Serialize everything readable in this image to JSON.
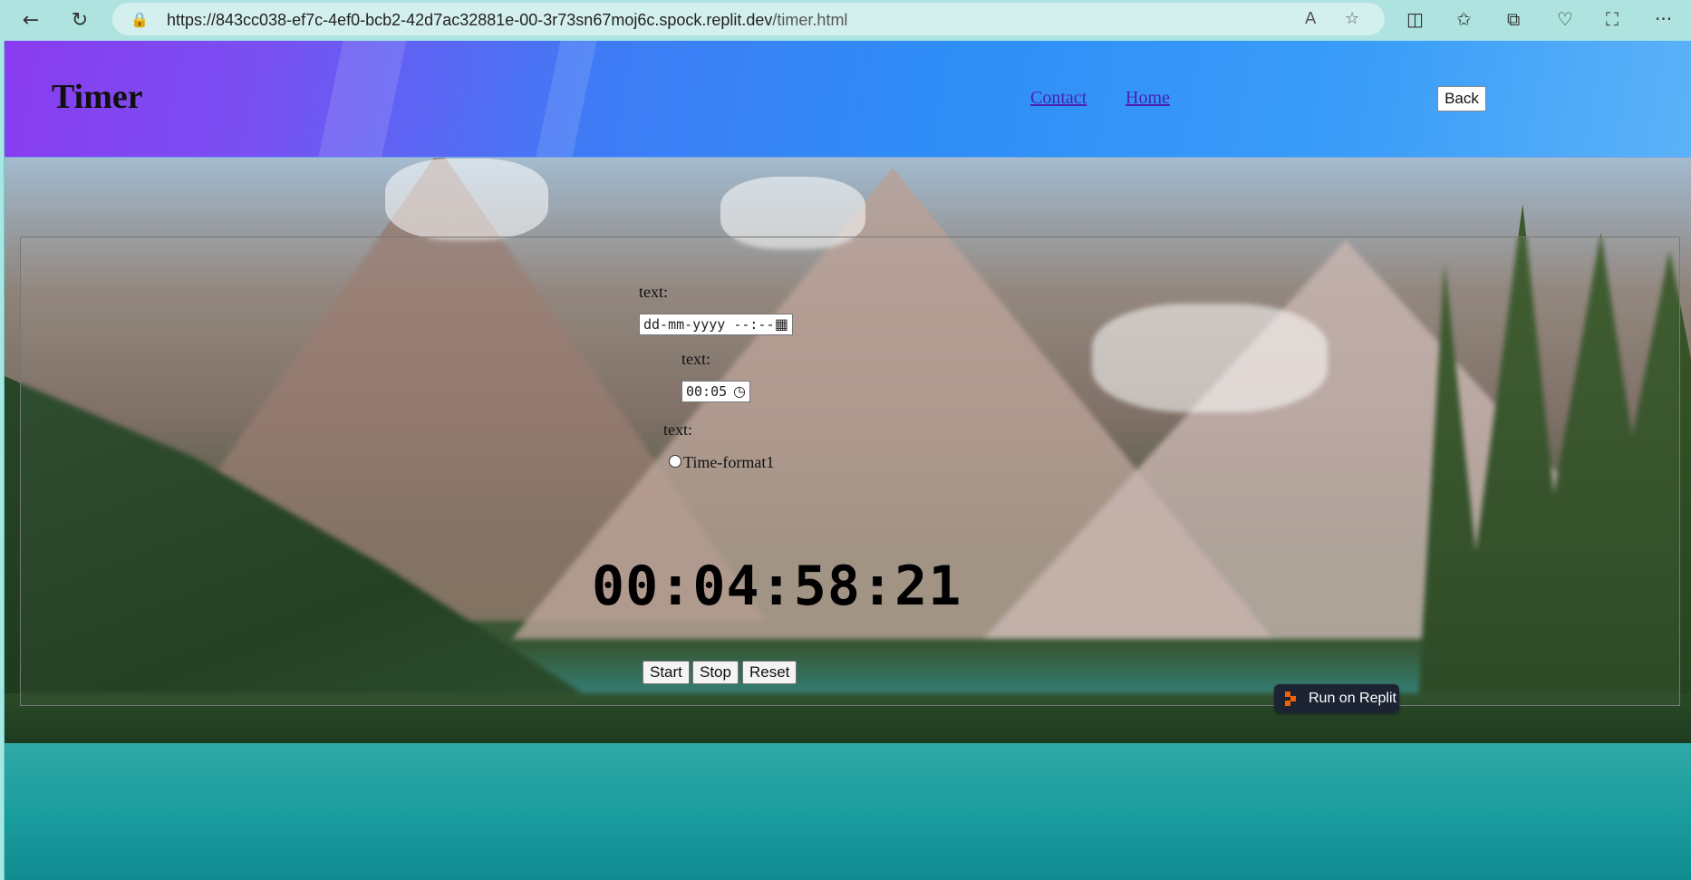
{
  "browser": {
    "url_host": "https://843cc038-ef7c-4ef0-bcb2-42d7ac32881e-00-3r73sn67moj6c.spock.replit.dev",
    "url_path": "/timer.html",
    "back_icon": "←",
    "refresh_icon": "↻",
    "lock_icon": "🔒",
    "read_aloud_icon": "A",
    "favorite_icon": "☆",
    "split_icon": "◫",
    "favorites_icon": "✩",
    "collections_icon": "⧉",
    "heart_icon": "♡",
    "screenshot_icon": "⛶",
    "more_icon": "···"
  },
  "header": {
    "title": "Timer",
    "nav": {
      "contact": "Contact",
      "home": "Home",
      "back": "Back"
    }
  },
  "timer": {
    "label1": "text:",
    "date_value": "dd-mm-yyyy --:--",
    "calendar_icon": "▦",
    "label2": "text:",
    "time_value": "00:05",
    "clock_icon": "◷",
    "label3": "text:",
    "radio_label": "Time-format1",
    "display": "00:04:58:21",
    "buttons": {
      "start": "Start",
      "stop": "Stop",
      "reset": "Reset"
    }
  },
  "badge": {
    "label": "Run on Replit"
  },
  "colors": {
    "header_start": "#8a3cf0",
    "header_end": "#5cb2f8",
    "badge_bg": "#1c2333",
    "replit_orange": "#f26207"
  }
}
